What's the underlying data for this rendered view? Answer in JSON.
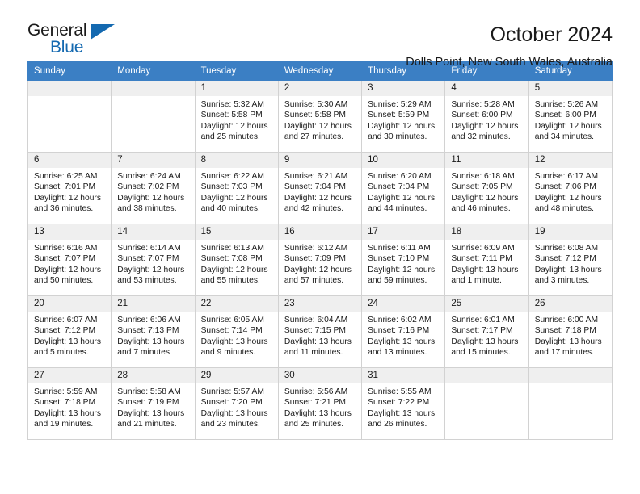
{
  "brand": {
    "name_part1": "General",
    "name_part2": "Blue",
    "accent_color": "#1469b0"
  },
  "header": {
    "title": "October 2024",
    "subtitle": "Dolls Point, New South Wales, Australia"
  },
  "calendar": {
    "header_color": "#3b7fc4",
    "weekdays": [
      "Sunday",
      "Monday",
      "Tuesday",
      "Wednesday",
      "Thursday",
      "Friday",
      "Saturday"
    ],
    "leading_blanks": 2,
    "days": [
      {
        "day": "1",
        "sunrise": "Sunrise: 5:32 AM",
        "sunset": "Sunset: 5:58 PM",
        "daylight_1": "Daylight: 12 hours",
        "daylight_2": "and 25 minutes."
      },
      {
        "day": "2",
        "sunrise": "Sunrise: 5:30 AM",
        "sunset": "Sunset: 5:58 PM",
        "daylight_1": "Daylight: 12 hours",
        "daylight_2": "and 27 minutes."
      },
      {
        "day": "3",
        "sunrise": "Sunrise: 5:29 AM",
        "sunset": "Sunset: 5:59 PM",
        "daylight_1": "Daylight: 12 hours",
        "daylight_2": "and 30 minutes."
      },
      {
        "day": "4",
        "sunrise": "Sunrise: 5:28 AM",
        "sunset": "Sunset: 6:00 PM",
        "daylight_1": "Daylight: 12 hours",
        "daylight_2": "and 32 minutes."
      },
      {
        "day": "5",
        "sunrise": "Sunrise: 5:26 AM",
        "sunset": "Sunset: 6:00 PM",
        "daylight_1": "Daylight: 12 hours",
        "daylight_2": "and 34 minutes."
      },
      {
        "day": "6",
        "sunrise": "Sunrise: 6:25 AM",
        "sunset": "Sunset: 7:01 PM",
        "daylight_1": "Daylight: 12 hours",
        "daylight_2": "and 36 minutes."
      },
      {
        "day": "7",
        "sunrise": "Sunrise: 6:24 AM",
        "sunset": "Sunset: 7:02 PM",
        "daylight_1": "Daylight: 12 hours",
        "daylight_2": "and 38 minutes."
      },
      {
        "day": "8",
        "sunrise": "Sunrise: 6:22 AM",
        "sunset": "Sunset: 7:03 PM",
        "daylight_1": "Daylight: 12 hours",
        "daylight_2": "and 40 minutes."
      },
      {
        "day": "9",
        "sunrise": "Sunrise: 6:21 AM",
        "sunset": "Sunset: 7:04 PM",
        "daylight_1": "Daylight: 12 hours",
        "daylight_2": "and 42 minutes."
      },
      {
        "day": "10",
        "sunrise": "Sunrise: 6:20 AM",
        "sunset": "Sunset: 7:04 PM",
        "daylight_1": "Daylight: 12 hours",
        "daylight_2": "and 44 minutes."
      },
      {
        "day": "11",
        "sunrise": "Sunrise: 6:18 AM",
        "sunset": "Sunset: 7:05 PM",
        "daylight_1": "Daylight: 12 hours",
        "daylight_2": "and 46 minutes."
      },
      {
        "day": "12",
        "sunrise": "Sunrise: 6:17 AM",
        "sunset": "Sunset: 7:06 PM",
        "daylight_1": "Daylight: 12 hours",
        "daylight_2": "and 48 minutes."
      },
      {
        "day": "13",
        "sunrise": "Sunrise: 6:16 AM",
        "sunset": "Sunset: 7:07 PM",
        "daylight_1": "Daylight: 12 hours",
        "daylight_2": "and 50 minutes."
      },
      {
        "day": "14",
        "sunrise": "Sunrise: 6:14 AM",
        "sunset": "Sunset: 7:07 PM",
        "daylight_1": "Daylight: 12 hours",
        "daylight_2": "and 53 minutes."
      },
      {
        "day": "15",
        "sunrise": "Sunrise: 6:13 AM",
        "sunset": "Sunset: 7:08 PM",
        "daylight_1": "Daylight: 12 hours",
        "daylight_2": "and 55 minutes."
      },
      {
        "day": "16",
        "sunrise": "Sunrise: 6:12 AM",
        "sunset": "Sunset: 7:09 PM",
        "daylight_1": "Daylight: 12 hours",
        "daylight_2": "and 57 minutes."
      },
      {
        "day": "17",
        "sunrise": "Sunrise: 6:11 AM",
        "sunset": "Sunset: 7:10 PM",
        "daylight_1": "Daylight: 12 hours",
        "daylight_2": "and 59 minutes."
      },
      {
        "day": "18",
        "sunrise": "Sunrise: 6:09 AM",
        "sunset": "Sunset: 7:11 PM",
        "daylight_1": "Daylight: 13 hours",
        "daylight_2": "and 1 minute."
      },
      {
        "day": "19",
        "sunrise": "Sunrise: 6:08 AM",
        "sunset": "Sunset: 7:12 PM",
        "daylight_1": "Daylight: 13 hours",
        "daylight_2": "and 3 minutes."
      },
      {
        "day": "20",
        "sunrise": "Sunrise: 6:07 AM",
        "sunset": "Sunset: 7:12 PM",
        "daylight_1": "Daylight: 13 hours",
        "daylight_2": "and 5 minutes."
      },
      {
        "day": "21",
        "sunrise": "Sunrise: 6:06 AM",
        "sunset": "Sunset: 7:13 PM",
        "daylight_1": "Daylight: 13 hours",
        "daylight_2": "and 7 minutes."
      },
      {
        "day": "22",
        "sunrise": "Sunrise: 6:05 AM",
        "sunset": "Sunset: 7:14 PM",
        "daylight_1": "Daylight: 13 hours",
        "daylight_2": "and 9 minutes."
      },
      {
        "day": "23",
        "sunrise": "Sunrise: 6:04 AM",
        "sunset": "Sunset: 7:15 PM",
        "daylight_1": "Daylight: 13 hours",
        "daylight_2": "and 11 minutes."
      },
      {
        "day": "24",
        "sunrise": "Sunrise: 6:02 AM",
        "sunset": "Sunset: 7:16 PM",
        "daylight_1": "Daylight: 13 hours",
        "daylight_2": "and 13 minutes."
      },
      {
        "day": "25",
        "sunrise": "Sunrise: 6:01 AM",
        "sunset": "Sunset: 7:17 PM",
        "daylight_1": "Daylight: 13 hours",
        "daylight_2": "and 15 minutes."
      },
      {
        "day": "26",
        "sunrise": "Sunrise: 6:00 AM",
        "sunset": "Sunset: 7:18 PM",
        "daylight_1": "Daylight: 13 hours",
        "daylight_2": "and 17 minutes."
      },
      {
        "day": "27",
        "sunrise": "Sunrise: 5:59 AM",
        "sunset": "Sunset: 7:18 PM",
        "daylight_1": "Daylight: 13 hours",
        "daylight_2": "and 19 minutes."
      },
      {
        "day": "28",
        "sunrise": "Sunrise: 5:58 AM",
        "sunset": "Sunset: 7:19 PM",
        "daylight_1": "Daylight: 13 hours",
        "daylight_2": "and 21 minutes."
      },
      {
        "day": "29",
        "sunrise": "Sunrise: 5:57 AM",
        "sunset": "Sunset: 7:20 PM",
        "daylight_1": "Daylight: 13 hours",
        "daylight_2": "and 23 minutes."
      },
      {
        "day": "30",
        "sunrise": "Sunrise: 5:56 AM",
        "sunset": "Sunset: 7:21 PM",
        "daylight_1": "Daylight: 13 hours",
        "daylight_2": "and 25 minutes."
      },
      {
        "day": "31",
        "sunrise": "Sunrise: 5:55 AM",
        "sunset": "Sunset: 7:22 PM",
        "daylight_1": "Daylight: 13 hours",
        "daylight_2": "and 26 minutes."
      }
    ]
  }
}
